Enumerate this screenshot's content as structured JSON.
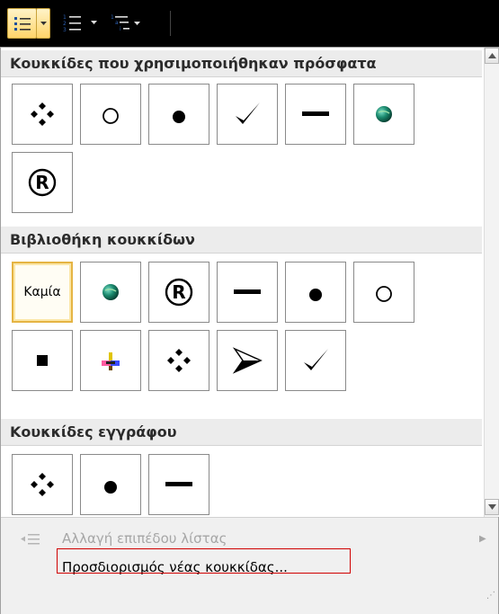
{
  "toolbar": {
    "bullets_icon": "bullets-icon",
    "numbering_icon": "numbering-icon",
    "multilevel_icon": "multilevel-list-icon",
    "dropdown_icon": "chevron-down-icon"
  },
  "sections": {
    "recent": {
      "title": "Κουκκίδες που χρησιμοποιήθηκαν πρόσφατα"
    },
    "library": {
      "title": "Βιβλιοθήκη κουκκίδων",
      "none_label": "Καμία"
    },
    "document": {
      "title": "Κουκκίδες εγγράφου"
    }
  },
  "recent_bullets": [
    "❖",
    "○",
    "●",
    "✓",
    "▬",
    "globe",
    "®"
  ],
  "library_bullets": [
    "none",
    "globe",
    "®",
    "▬",
    "●",
    "○",
    "■",
    "color-plus",
    "❖",
    "➤",
    "✓"
  ],
  "document_bullets": [
    "❖",
    "●",
    "▬"
  ],
  "menu": {
    "change_level": "Αλλαγή επιπέδου λίστας",
    "define_new": "Προσδιορισμός νέας κουκκίδας..."
  },
  "colors": {
    "selection_border": "#e5b443",
    "highlight_box": "#d00000",
    "toolbar_active": "#ffd56a"
  }
}
